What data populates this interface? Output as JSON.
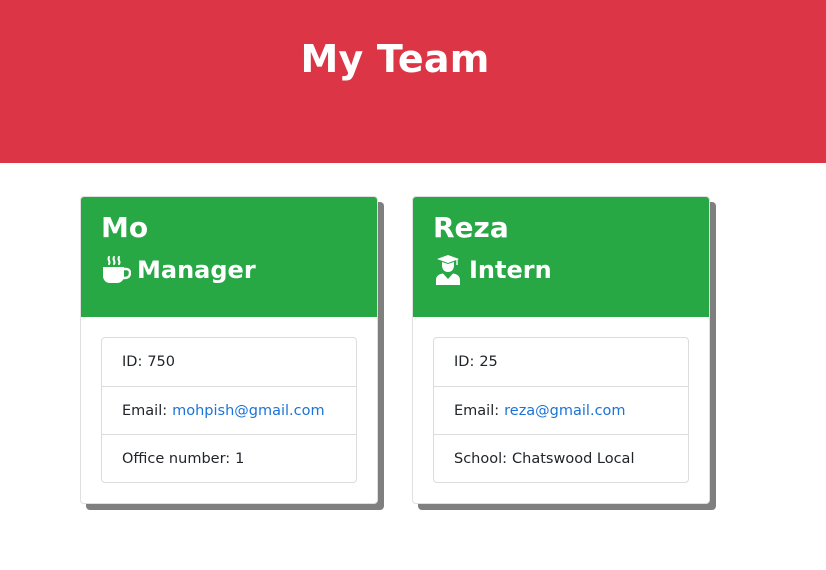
{
  "header": {
    "title": "My Team"
  },
  "team": [
    {
      "name": "Mo",
      "role": "Manager",
      "role_icon": "mug-hot-icon",
      "id_label": "ID:",
      "id": "750",
      "email_label": "Email:",
      "email": "mohpish@gmail.com",
      "extra_label": "Office number:",
      "extra_value": "1"
    },
    {
      "name": "Reza",
      "role": "Intern",
      "role_icon": "user-graduate-icon",
      "id_label": "ID:",
      "id": "25",
      "email_label": "Email:",
      "email": "reza@gmail.com",
      "extra_label": "School:",
      "extra_value": "Chatswood Local"
    }
  ],
  "colors": {
    "header_bg": "#dc3545",
    "card_header_bg": "#28a745",
    "link": "#1a73d9",
    "shadow": "#7f7f7f"
  }
}
